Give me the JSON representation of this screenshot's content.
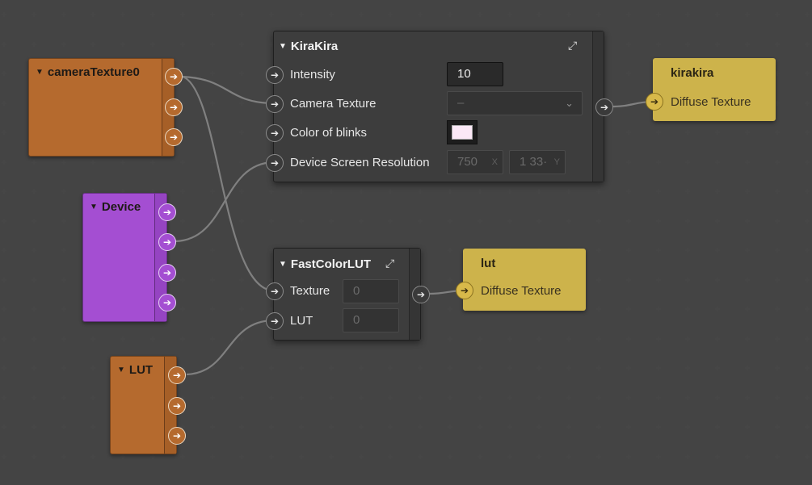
{
  "nodes": {
    "camera": {
      "title": "cameraTexture0",
      "color": "#b56a2e"
    },
    "device": {
      "title": "Device",
      "color": "#a44ed2"
    },
    "lut_source": {
      "title": "LUT",
      "color": "#b56a2e"
    },
    "kirakira_panel": {
      "title": "KiraKira",
      "rows": {
        "intensity": {
          "label": "Intensity",
          "value": "10"
        },
        "camera_texture": {
          "label": "Camera Texture",
          "value": "–"
        },
        "color_of_blinks": {
          "label": "Color of blinks",
          "color": "#fbe8f6"
        },
        "device_screen_resolution": {
          "label": "Device Screen Resolution",
          "x": "750",
          "x_axis": "X",
          "y": "1 33·",
          "y_axis": "Y"
        }
      }
    },
    "fastcolorlut_panel": {
      "title": "FastColorLUT",
      "rows": {
        "texture": {
          "label": "Texture",
          "value": "0"
        },
        "lut": {
          "label": "LUT",
          "value": "0"
        }
      }
    },
    "kirakira_output": {
      "title": "kirakira",
      "port_label": "Diffuse Texture",
      "color": "#cdb34b"
    },
    "lut_output": {
      "title": "lut",
      "port_label": "Diffuse Texture",
      "color": "#cdb34b"
    }
  },
  "icons": {
    "port": "arrow-right-icon",
    "collapse": "triangle-down-icon",
    "expand": "expand-arrows-icon",
    "dropdown": "chevron-down-icon"
  }
}
